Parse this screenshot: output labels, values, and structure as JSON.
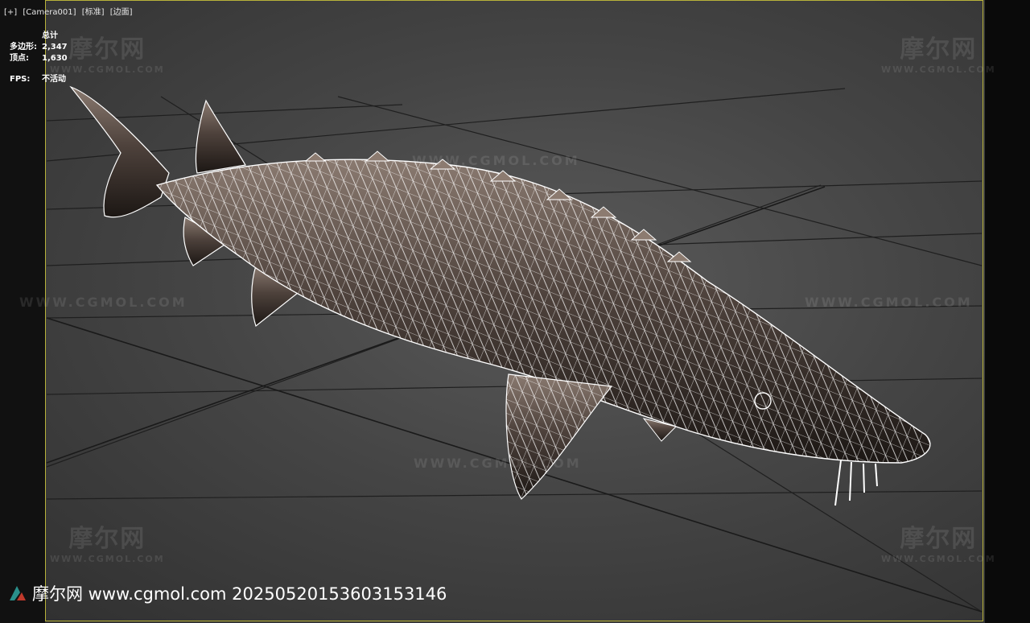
{
  "viewport": {
    "menu": [
      "[+]",
      "[Camera001]",
      "[标准]",
      "[边面]"
    ],
    "stats": {
      "title": "总计",
      "polygons_label": "多边形:",
      "polygons_value": "2,347",
      "vertices_label": "顶点:",
      "vertices_value": "1,630",
      "fps_label": "FPS:",
      "fps_value": "不活动"
    },
    "colors": {
      "frame": "#b8b23a",
      "wire": "#ffffff",
      "fish_body": "#5e5048",
      "grid": "#1e1e1e"
    }
  },
  "watermarks": {
    "brand_cn": "摩尔网",
    "brand_en": "WWW.CGMOL.COM",
    "line_text": "WWW.CGMOL.COM"
  },
  "footer": {
    "text": "摩尔网 www.cgmol.com 20250520153603153146",
    "logo_icon": "cgmol-logo-icon"
  }
}
